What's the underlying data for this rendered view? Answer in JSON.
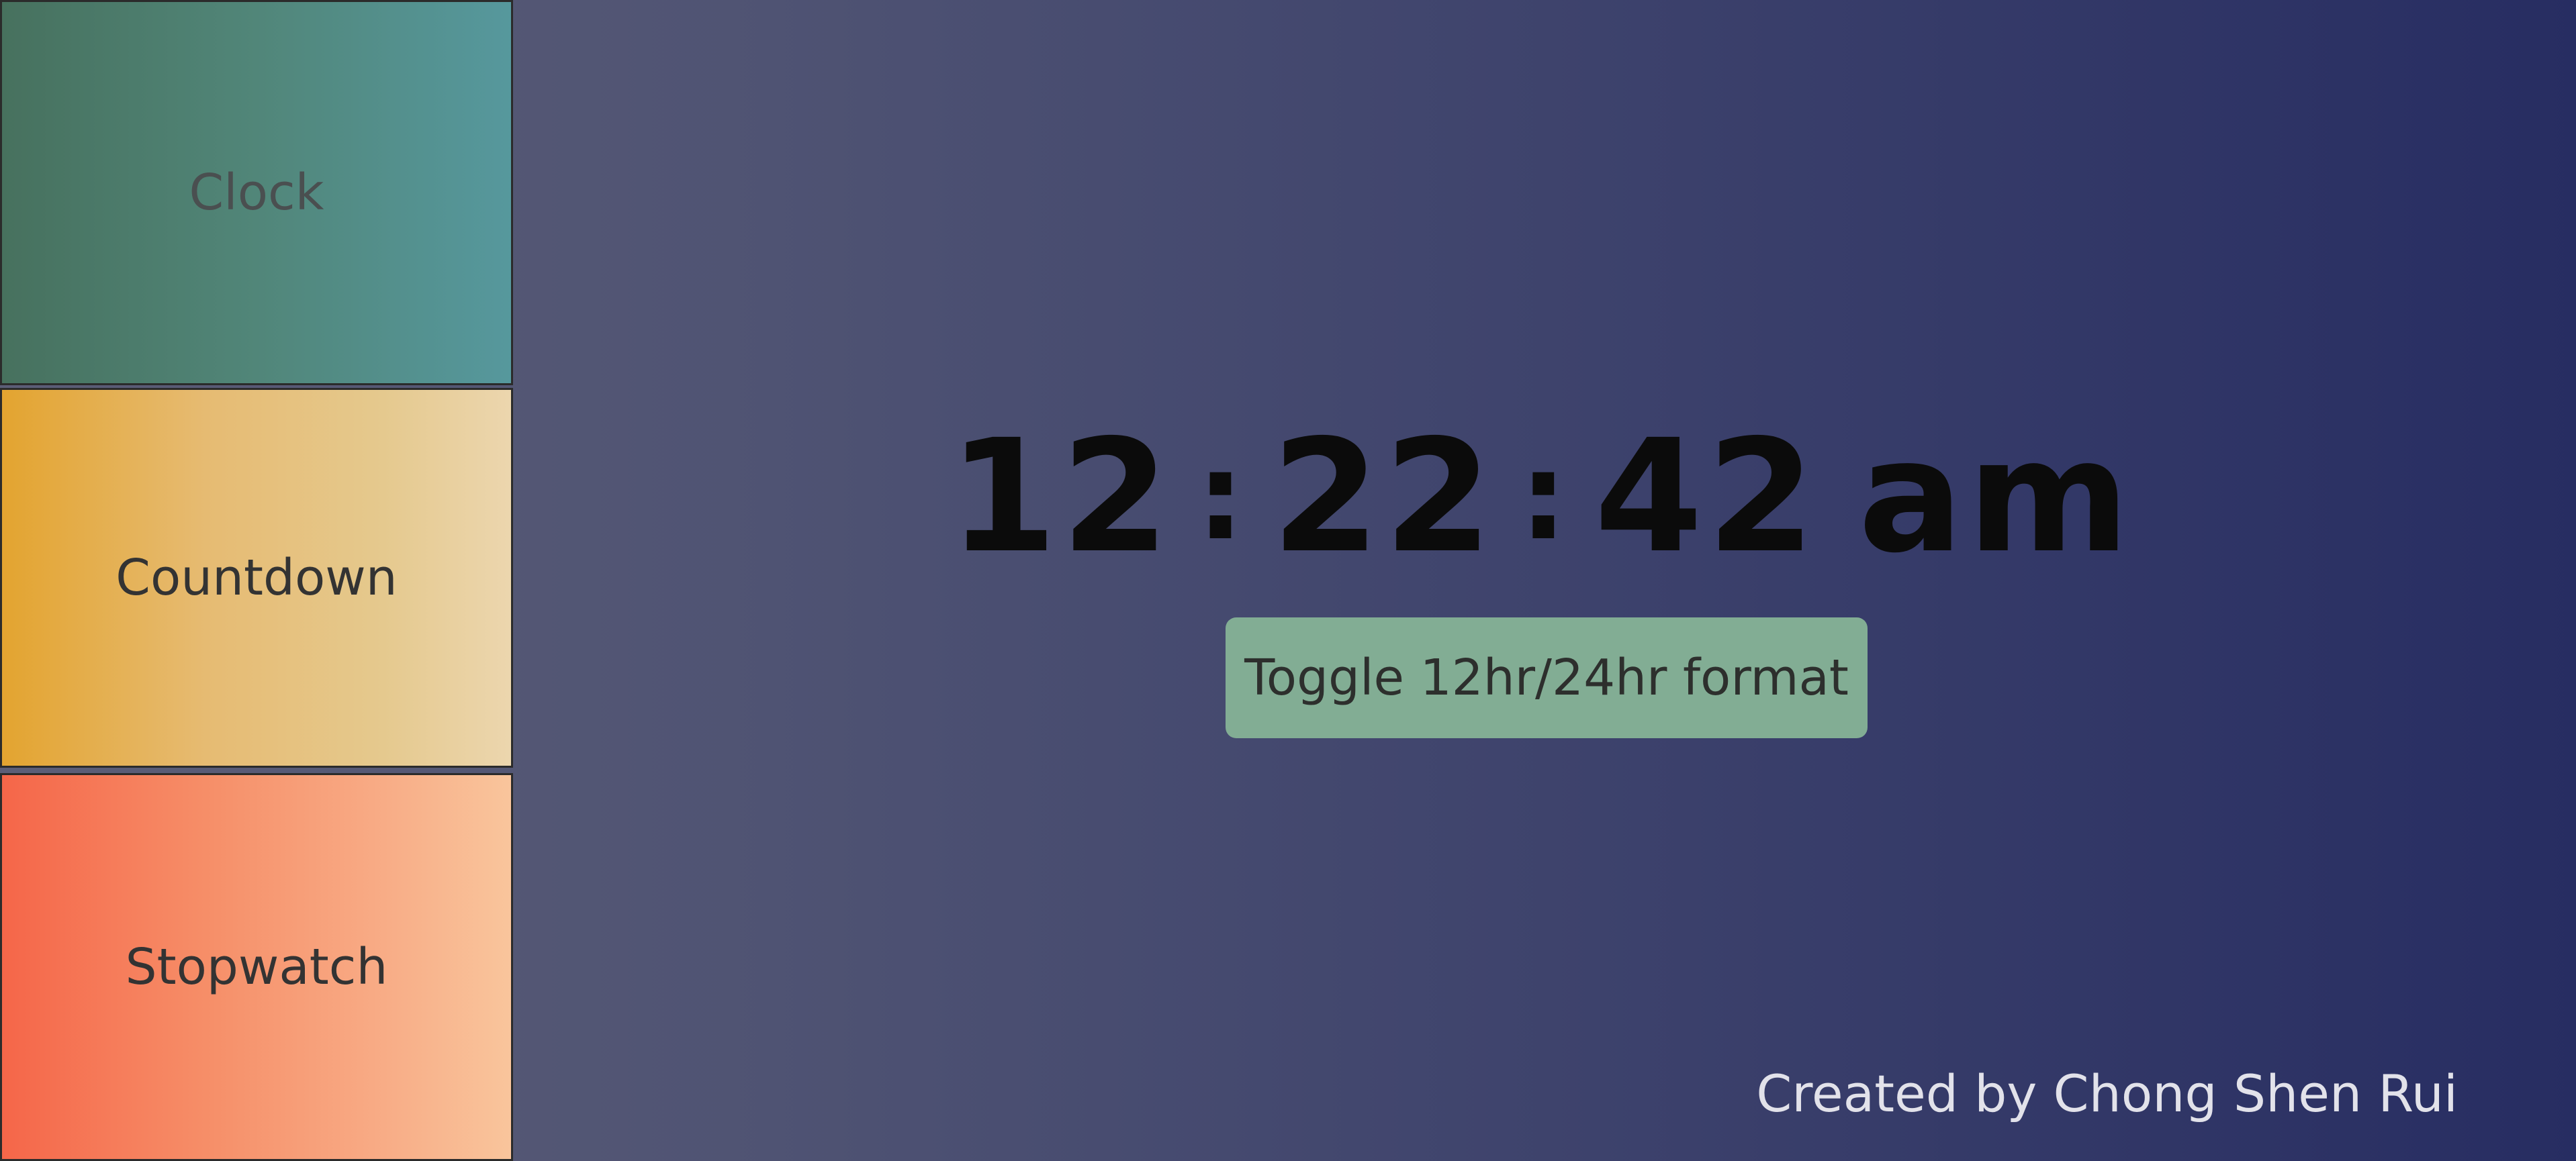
{
  "sidebar": {
    "items": [
      {
        "label": "Clock",
        "active": true
      },
      {
        "label": "Countdown"
      },
      {
        "label": "Stopwatch"
      }
    ]
  },
  "clock": {
    "hours": "12",
    "minutes": "22",
    "seconds": "42",
    "separator": ":",
    "period": "am"
  },
  "toggle": {
    "label": "Toggle 12hr/24hr format"
  },
  "footer": {
    "credit": "Created by Chong Shen Rui"
  },
  "colors": {
    "background_start": "#5c5e77",
    "background_end": "#272d62",
    "clock_tile": "#518679",
    "countdown_tile": "#e6bb72",
    "stopwatch_tile": "#f68e68",
    "toggle_button": "#82ad94"
  }
}
